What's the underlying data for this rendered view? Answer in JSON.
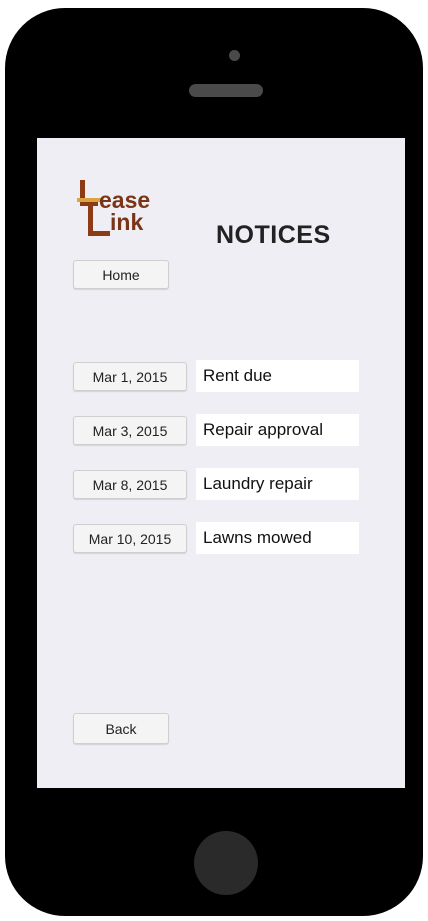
{
  "app": {
    "logo_line1": "ease",
    "logo_line2": "ink",
    "logo_full_text": "LeaseLink",
    "colors": {
      "logo_brown": "#8c3b16",
      "logo_gold": "#d9a441",
      "screen_bg": "#efeef4"
    }
  },
  "header": {
    "title": "NOTICES",
    "home_label": "Home"
  },
  "notices": [
    {
      "date": "Mar 1, 2015",
      "text": "Rent due"
    },
    {
      "date": "Mar 3, 2015",
      "text": "Repair approval"
    },
    {
      "date": "Mar 8, 2015",
      "text": "Laundry repair"
    },
    {
      "date": "Mar 10, 2015",
      "text": "Lawns mowed"
    }
  ],
  "footer": {
    "back_label": "Back"
  }
}
